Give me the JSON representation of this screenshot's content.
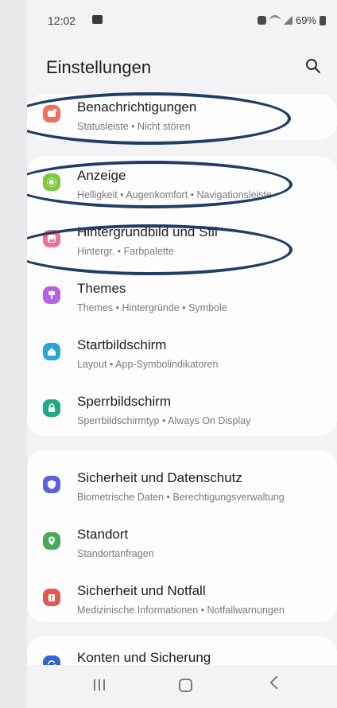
{
  "status": {
    "time": "12:02",
    "battery": "69%"
  },
  "header": {
    "title": "Einstellungen"
  },
  "groups": [
    [
      {
        "id": "benachrichtigungen",
        "title": "Benachrichtigungen",
        "subtitle": "Statusleiste  •  Nicht stören",
        "color": "#f0705f",
        "icon": "bell-box-icon"
      }
    ],
    [
      {
        "id": "anzeige",
        "title": "Anzeige",
        "subtitle": "Helligkeit  •  Augenkomfort  •  Navigationsleiste",
        "color": "#7fc940",
        "icon": "sun-icon"
      },
      {
        "id": "hintergrund",
        "title": "Hintergrundbild und Stil",
        "subtitle": "Hintergr.  •  Farbpalette",
        "color": "#ef6f95",
        "icon": "image-icon"
      },
      {
        "id": "themes",
        "title": "Themes",
        "subtitle": "Themes  •  Hintergründe  •  Symbole",
        "color": "#b463e0",
        "icon": "brush-icon"
      },
      {
        "id": "startbildschirm",
        "title": "Startbildschirm",
        "subtitle": "Layout  •  App-Symbolindikatoren",
        "color": "#27a6d8",
        "icon": "home-icon"
      },
      {
        "id": "sperrbildschirm",
        "title": "Sperrbildschirm",
        "subtitle": "Sperrbildschirmtyp  •  Always On Display",
        "color": "#1fa985",
        "icon": "lock-icon"
      }
    ],
    [
      {
        "id": "sicherheit",
        "title": "Sicherheit und Datenschutz",
        "subtitle": "Biometrische Daten  •  Berechtigungsverwaltung",
        "color": "#5b63d9",
        "icon": "shield-icon"
      },
      {
        "id": "standort",
        "title": "Standort",
        "subtitle": "Standortanfragen",
        "color": "#49ab59",
        "icon": "location-icon"
      },
      {
        "id": "notfall",
        "title": "Sicherheit und Notfall",
        "subtitle": "Medizinische Informationen  •  Notfallwarnungen",
        "color": "#e0594f",
        "icon": "emergency-icon"
      }
    ],
    [
      {
        "id": "konten",
        "title": "Konten und Sicherung",
        "subtitle": "",
        "color": "#2f66d2",
        "icon": "sync-icon"
      }
    ]
  ],
  "highlight_color": "#1f3d66"
}
